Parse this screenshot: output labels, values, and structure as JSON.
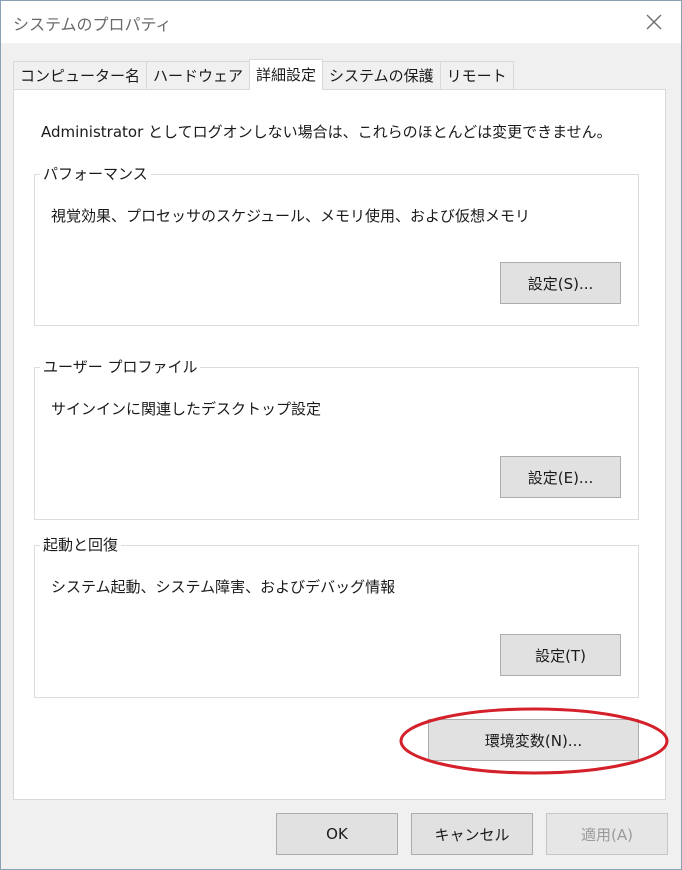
{
  "window": {
    "title": "システムのプロパティ",
    "close_icon": "close-icon"
  },
  "tabs": [
    {
      "label": "コンピューター名",
      "active": false
    },
    {
      "label": "ハードウェア",
      "active": false
    },
    {
      "label": "詳細設定",
      "active": true
    },
    {
      "label": "システムの保護",
      "active": false
    },
    {
      "label": "リモート",
      "active": false
    }
  ],
  "panel": {
    "intro": "Administrator としてログオンしない場合は、これらのほとんどは変更できません。",
    "performance": {
      "legend": "パフォーマンス",
      "description": "視覚効果、プロセッサのスケジュール、メモリ使用、および仮想メモリ",
      "button": "設定(S)..."
    },
    "user_profile": {
      "legend": "ユーザー プロファイル",
      "description": "サインインに関連したデスクトップ設定",
      "button": "設定(E)..."
    },
    "startup_recovery": {
      "legend": "起動と回復",
      "description": "システム起動、システム障害、およびデバッグ情報",
      "button": "設定(T)"
    },
    "env_button": "環境変数(N)..."
  },
  "footer": {
    "ok": "OK",
    "cancel": "キャンセル",
    "apply": "適用(A)"
  },
  "colors": {
    "highlight_ellipse": "#d4202a",
    "button_face": "#e1e1e1",
    "disabled_text": "#9a9a9a"
  }
}
